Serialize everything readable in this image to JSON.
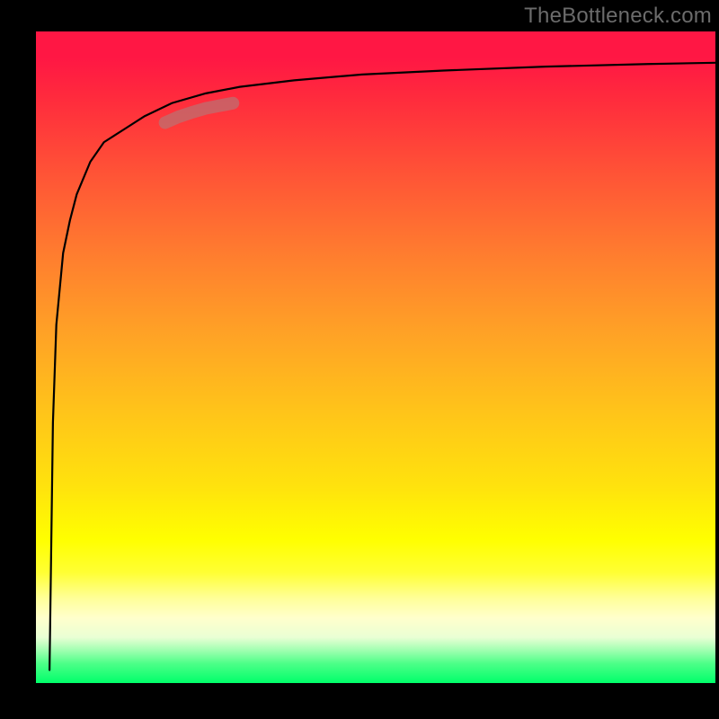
{
  "watermark": "TheBottleneck.com",
  "chart_data": {
    "type": "line",
    "title": "",
    "xlabel": "",
    "ylabel": "",
    "xlim": [
      0,
      100
    ],
    "ylim": [
      0,
      100
    ],
    "grid": false,
    "legend": false,
    "background_gradient": {
      "direction": "vertical",
      "stops": [
        {
          "pos": 0.0,
          "color": "#ff1744"
        },
        {
          "pos": 0.5,
          "color": "#ffa126"
        },
        {
          "pos": 0.78,
          "color": "#ffff00"
        },
        {
          "pos": 1.0,
          "color": "#00ff6a"
        }
      ]
    },
    "series": [
      {
        "name": "main-curve",
        "color": "#000000",
        "x": [
          2,
          2.5,
          3,
          4,
          5,
          6,
          8,
          10,
          13,
          16,
          20,
          25,
          30,
          38,
          48,
          60,
          75,
          90,
          100
        ],
        "values": [
          2,
          40,
          55,
          66,
          71,
          75,
          80,
          83,
          85,
          87,
          89,
          90.5,
          91.5,
          92.5,
          93.4,
          94,
          94.6,
          95,
          95.2
        ]
      },
      {
        "name": "highlight-segment",
        "color": "rgba(180,120,120,0.65)",
        "stroke_width": 14,
        "x": [
          19,
          21,
          23,
          25,
          27,
          29
        ],
        "values": [
          86.0,
          86.9,
          87.6,
          88.2,
          88.6,
          89.0
        ]
      }
    ]
  }
}
